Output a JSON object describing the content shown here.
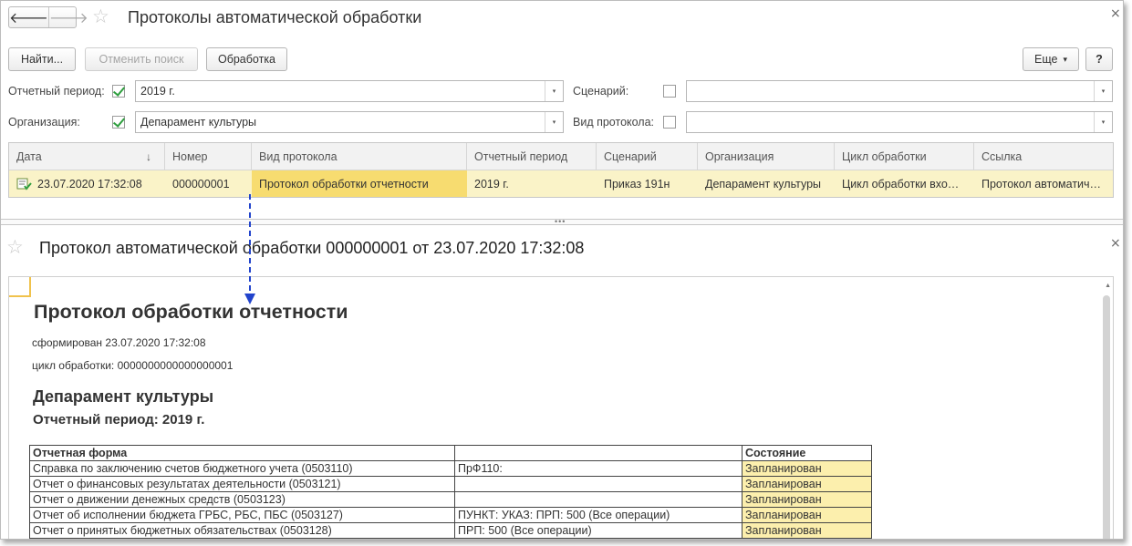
{
  "window1": {
    "title": "Протоколы автоматической обработки",
    "nav_back": "🡐",
    "nav_forward": "🡒",
    "star": "☆",
    "close": "×"
  },
  "toolbar": {
    "find": "Найти...",
    "cancel_search": "Отменить поиск",
    "process": "Обработка",
    "more": "Еще",
    "more_chevron": "▾",
    "help": "?"
  },
  "filters": {
    "period_label": "Отчетный период:",
    "period_checked": true,
    "period_value": "2019 г.",
    "org_label": "Организация:",
    "org_checked": true,
    "org_value": "Депарамент культуры",
    "scenario_label": "Сценарий:",
    "scenario_checked": false,
    "scenario_value": "",
    "protocol_type_label": "Вид протокола:",
    "protocol_type_checked": false,
    "protocol_type_value": "",
    "dropdown_glyph": "▾"
  },
  "grid": {
    "columns": [
      "Дата",
      "Номер",
      "Вид протокола",
      "Отчетный период",
      "Сценарий",
      "Организация",
      "Цикл обработки",
      "Ссылка"
    ],
    "sort_glyph": "↓",
    "rows": [
      [
        "23.07.2020 17:32:08",
        "000000001",
        "Протокол обработки отчетности",
        "2019 г.",
        "Приказ 191н",
        "Депарамент культуры",
        "Цикл обработки вхо…",
        "Протокол автоматич…"
      ]
    ]
  },
  "splitter_dots": "•••",
  "window2": {
    "title": "Протокол автоматической обработки 000000001 от 23.07.2020 17:32:08",
    "star": "☆",
    "close": "×"
  },
  "report": {
    "heading": "Протокол обработки отчетности",
    "formed": "сформирован 23.07.2020 17:32:08",
    "cycle": "цикл обработки: 0000000000000000001",
    "org": "Депарамент культуры",
    "period": "Отчетный период: 2019 г.",
    "table_header": [
      "Отчетная форма",
      "",
      "Состояние"
    ],
    "table_rows": [
      [
        "Справка по заключению счетов бюджетного учета (0503110)",
        "ПрФ110:",
        "Запланирован"
      ],
      [
        "Отчет о финансовых результатах деятельности (0503121)",
        "",
        "Запланирован"
      ],
      [
        "Отчет о движении денежных средств (0503123)",
        "",
        "Запланирован"
      ],
      [
        "Отчет об исполнении бюджета ГРБС, РБС, ПБС (0503127)",
        "ПУНКТ:  УКАЗ:  ПРП: 500 (Все операции)",
        "Запланирован"
      ],
      [
        "Отчет о принятых бюджетных обязательствах (0503128)",
        "ПРП: 500 (Все операции)",
        "Запланирован"
      ]
    ]
  },
  "colors": {
    "selected_row": "#faf3c8",
    "selected_cell": "#f7dc70",
    "status_cell": "#fcefad",
    "arrow": "#2244cc"
  }
}
